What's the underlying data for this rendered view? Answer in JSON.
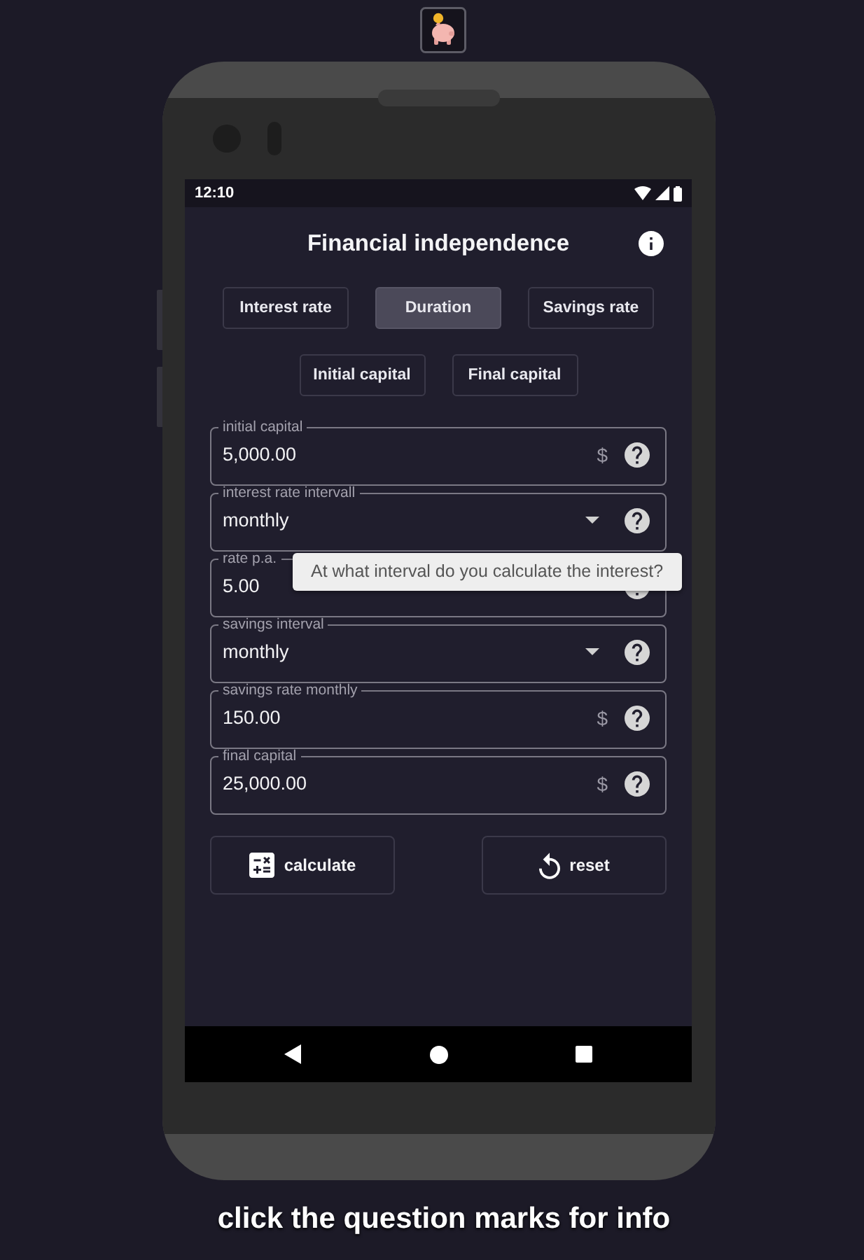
{
  "status_bar": {
    "time": "12:10"
  },
  "header": {
    "title": "Financial independence"
  },
  "tabs": [
    {
      "label": "Interest rate",
      "selected": false
    },
    {
      "label": "Duration",
      "selected": true
    },
    {
      "label": "Savings rate",
      "selected": false
    },
    {
      "label": "Initial capital",
      "selected": false
    },
    {
      "label": "Final capital",
      "selected": false
    }
  ],
  "fields": [
    {
      "kind": "number",
      "label": "initial capital",
      "value": "5,000.00",
      "suffix": "$"
    },
    {
      "kind": "select",
      "label": "interest rate intervall",
      "value": "monthly",
      "tooltip": "At what interval do you calculate the interest?"
    },
    {
      "kind": "number",
      "label": "rate p.a.",
      "value": "5.00"
    },
    {
      "kind": "select",
      "label": "savings interval",
      "value": "monthly"
    },
    {
      "kind": "number",
      "label": "savings rate monthly",
      "value": "150.00",
      "suffix": "$"
    },
    {
      "kind": "number",
      "label": "final capital",
      "value": "25,000.00",
      "suffix": "$"
    }
  ],
  "buttons": [
    {
      "kind": "calculate",
      "label": "calculate"
    },
    {
      "kind": "reset",
      "label": "reset"
    }
  ],
  "caption": "click the question marks for info"
}
